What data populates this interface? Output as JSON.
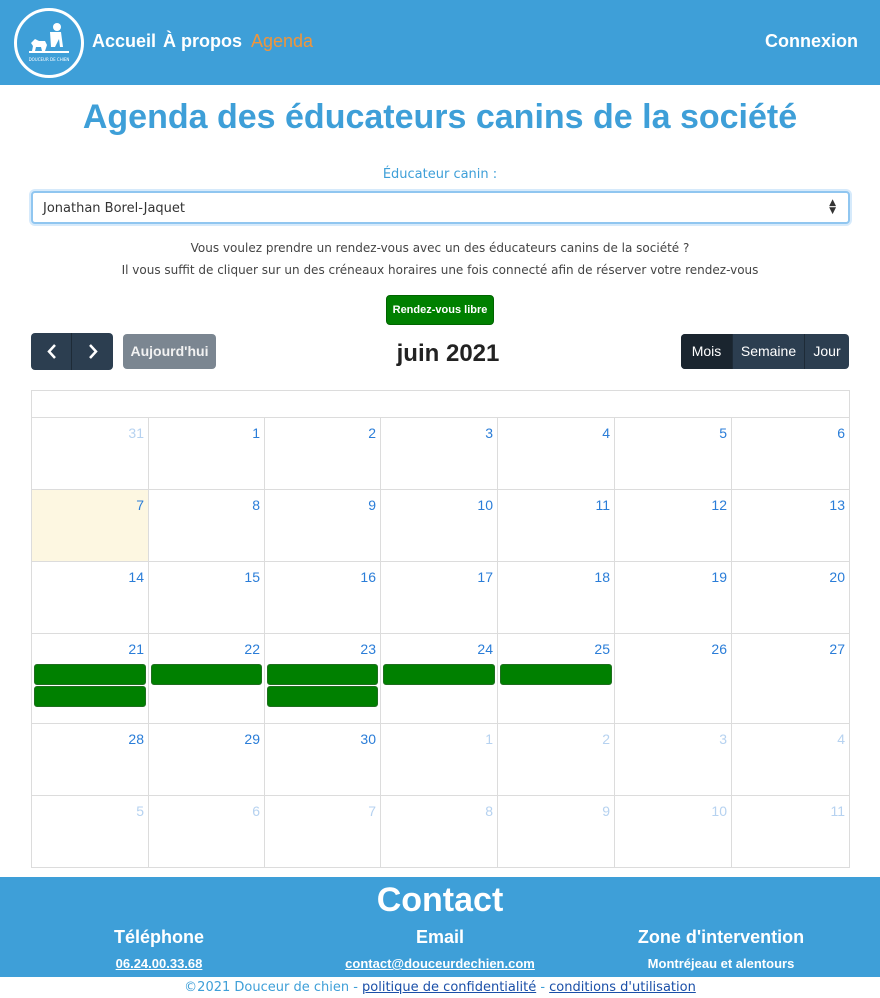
{
  "nav": {
    "logo_text": "DOUCEUR DE CHIEN",
    "links": [
      "Accueil",
      "À propos",
      "Agenda"
    ],
    "connexion": "Connexion"
  },
  "page": {
    "title": "Agenda des éducateurs canins de la société",
    "select_label": "Éducateur canin :",
    "select_value": "Jonathan Borel-Jaquet",
    "info_line1": "Vous voulez prendre un rendez-vous avec un des éducateurs canins de la société ?",
    "info_line2": "Il vous suffit de cliquer sur un des créneaux horaires une fois connecté afin de réserver votre rendez-vous",
    "legend_free": "Rendez-vous libre"
  },
  "calendar": {
    "title": "juin 2021",
    "today_label": "Aujourd'hui",
    "views": [
      "Mois",
      "Semaine",
      "Jour"
    ],
    "active_view": "Mois",
    "weeks": [
      [
        {
          "d": "31",
          "o": true
        },
        {
          "d": "1"
        },
        {
          "d": "2"
        },
        {
          "d": "3"
        },
        {
          "d": "4"
        },
        {
          "d": "5"
        },
        {
          "d": "6"
        }
      ],
      [
        {
          "d": "7",
          "today": true
        },
        {
          "d": "8"
        },
        {
          "d": "9"
        },
        {
          "d": "10"
        },
        {
          "d": "11"
        },
        {
          "d": "12"
        },
        {
          "d": "13"
        }
      ],
      [
        {
          "d": "14"
        },
        {
          "d": "15"
        },
        {
          "d": "16"
        },
        {
          "d": "17"
        },
        {
          "d": "18"
        },
        {
          "d": "19"
        },
        {
          "d": "20"
        }
      ],
      [
        {
          "d": "21",
          "ev": 2
        },
        {
          "d": "22",
          "ev": 1
        },
        {
          "d": "23",
          "ev": 2
        },
        {
          "d": "24",
          "ev": 1
        },
        {
          "d": "25",
          "ev": 1
        },
        {
          "d": "26"
        },
        {
          "d": "27"
        }
      ],
      [
        {
          "d": "28"
        },
        {
          "d": "29"
        },
        {
          "d": "30"
        },
        {
          "d": "1",
          "o": true
        },
        {
          "d": "2",
          "o": true
        },
        {
          "d": "3",
          "o": true
        },
        {
          "d": "4",
          "o": true
        }
      ],
      [
        {
          "d": "5",
          "o": true
        },
        {
          "d": "6",
          "o": true
        },
        {
          "d": "7",
          "o": true
        },
        {
          "d": "8",
          "o": true
        },
        {
          "d": "9",
          "o": true
        },
        {
          "d": "10",
          "o": true
        },
        {
          "d": "11",
          "o": true
        }
      ]
    ]
  },
  "footer": {
    "title": "Contact",
    "tel_h": "Téléphone",
    "tel_v": "06.24.00.33.68",
    "mail_h": "Email",
    "mail_v": "contact@douceurdechien.com",
    "zone_h": "Zone d'intervention",
    "zone_v": "Montréjeau et alentours",
    "copyright": "©2021 Douceur de chien - ",
    "privacy": "politique de confidentialité",
    "sep": " - ",
    "terms": "conditions d'utilisation"
  },
  "colors": {
    "primary": "#3e9fd8",
    "active_nav": "#f0953a",
    "event": "#008000",
    "dark_btn": "#2c3e50",
    "today_bg": "#fdf7e1"
  }
}
